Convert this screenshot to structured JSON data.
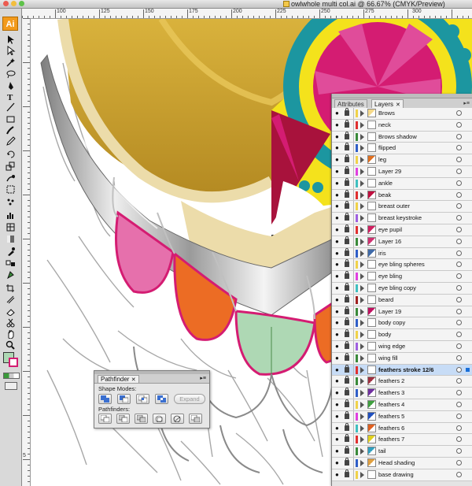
{
  "window": {
    "title": "owlwhole multi col.ai @ 66.67% (CMYK/Preview)"
  },
  "toolbox": {
    "badge": "Ai",
    "tools": [
      "selection-tool",
      "direct-selection-tool",
      "magic-wand-tool",
      "lasso-tool",
      "pen-tool",
      "type-tool",
      "line-tool",
      "rectangle-tool",
      "paintbrush-tool",
      "pencil-tool",
      "rotate-tool",
      "scale-tool",
      "warp-tool",
      "free-transform-tool",
      "symbol-sprayer-tool",
      "column-graph-tool",
      "mesh-tool",
      "gradient-tool",
      "eyedropper-tool",
      "blend-tool",
      "live-paint-tool",
      "crop-tool",
      "slice-tool",
      "eraser-tool",
      "scissors-tool",
      "hand-tool",
      "zoom-tool"
    ]
  },
  "rulers": {
    "top": [
      "100",
      "125",
      "150",
      "175",
      "200",
      "225",
      "250",
      "275",
      "300"
    ],
    "left": [
      "5"
    ]
  },
  "layers_panel": {
    "tabs": [
      {
        "label": "Attributes",
        "active": false
      },
      {
        "label": "Layers",
        "active": true
      }
    ],
    "close_glyph": "✕",
    "menu_glyph": "▸≡",
    "visibility_glyph": "●",
    "layers": [
      {
        "name": "Brows",
        "color": "#f0d24a",
        "thumb": "#f5d98a"
      },
      {
        "name": "neck",
        "color": "#e03030",
        "thumb": "#ffffff"
      },
      {
        "name": "Brows shadow",
        "color": "#3a8a3a",
        "thumb": "#ffffff"
      },
      {
        "name": "flipped",
        "color": "#2f5ec8",
        "thumb": "#ffffff"
      },
      {
        "name": "leg",
        "color": "#f0d24a",
        "thumb": "#e07020"
      },
      {
        "name": "Layer 29",
        "color": "#e040e0",
        "thumb": "#ffffff"
      },
      {
        "name": "ankle",
        "color": "#40c0c0",
        "thumb": "#ffffff"
      },
      {
        "name": "beak",
        "color": "#e03030",
        "thumb": "#c01040"
      },
      {
        "name": "breast outer",
        "color": "#f0d24a",
        "thumb": "#ffffff"
      },
      {
        "name": "breast keystroke",
        "color": "#a060e0",
        "thumb": "#ffffff"
      },
      {
        "name": "eye pupil",
        "color": "#e03030",
        "thumb": "#d02060"
      },
      {
        "name": "Layer 16",
        "color": "#3a8a3a",
        "thumb": "#d03070"
      },
      {
        "name": "iris",
        "color": "#2f5ec8",
        "thumb": "#3f6aa8"
      },
      {
        "name": "eye bling spheres",
        "color": "#f0d24a",
        "thumb": "#ffffff"
      },
      {
        "name": "eye bling",
        "color": "#e040e0",
        "thumb": "#ffffff"
      },
      {
        "name": "eye bling copy",
        "color": "#40c0c0",
        "thumb": "#ffffff"
      },
      {
        "name": "beard",
        "color": "#a02020",
        "thumb": "#ffffff"
      },
      {
        "name": "Layer 19",
        "color": "#3a8a3a",
        "thumb": "#c01060"
      },
      {
        "name": "body copy",
        "color": "#2f5ec8",
        "thumb": "#ffffff"
      },
      {
        "name": "body",
        "color": "#f0d24a",
        "thumb": "#ffffff"
      },
      {
        "name": "wing edge",
        "color": "#a060e0",
        "thumb": "#ffffff"
      },
      {
        "name": "wing fill",
        "color": "#3a8a3a",
        "thumb": "#ffffff"
      },
      {
        "name": "feathers stroke 12/6",
        "color": "#e03030",
        "thumb": "#ffffff",
        "selected": true
      },
      {
        "name": "feathers 2",
        "color": "#3a8a3a",
        "thumb": "#a03040"
      },
      {
        "name": "feathers 3",
        "color": "#2f5ec8",
        "thumb": "#7030a0"
      },
      {
        "name": "feathers 4",
        "color": "#f0d24a",
        "thumb": "#40a040"
      },
      {
        "name": "feathers 5",
        "color": "#e040e0",
        "thumb": "#2050c0"
      },
      {
        "name": "feathers 6",
        "color": "#40c0c0",
        "thumb": "#e06020"
      },
      {
        "name": "feathers 7",
        "color": "#e03030",
        "thumb": "#e0d020"
      },
      {
        "name": "tail",
        "color": "#3a8a3a",
        "thumb": "#30a0c0"
      },
      {
        "name": "Head shading",
        "color": "#2f5ec8",
        "thumb": "#e0a040"
      },
      {
        "name": "base drawing",
        "color": "#f0d24a",
        "thumb": "#ffffff"
      }
    ]
  },
  "pathfinder": {
    "tab": "Pathfinder",
    "close_glyph": "✕",
    "menu_glyph": "▸≡",
    "shape_modes_label": "Shape Modes:",
    "pathfinders_label": "Pathfinders:",
    "expand_label": "Expand",
    "shape_mode_buttons": [
      "unite",
      "minus-front",
      "intersect",
      "exclude"
    ],
    "pathfinder_buttons": [
      "divide",
      "trim",
      "merge",
      "crop",
      "outline",
      "minus-back"
    ]
  },
  "colors": {
    "gold": "#b38a24",
    "cream": "#ecdcaa",
    "magenta": "#d41c72",
    "pink": "#e670ac",
    "orange": "#ec6c24",
    "mint": "#aed8b4",
    "teal": "#1c96a0",
    "yellow": "#f4e21c",
    "crimson": "#a8123c",
    "selection": "#c7dcf6"
  }
}
